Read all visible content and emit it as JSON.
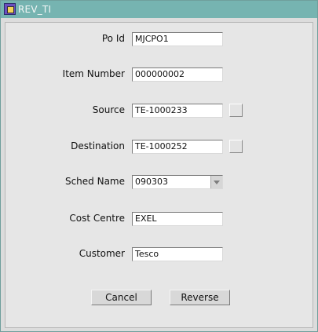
{
  "window": {
    "title": "REV_TI"
  },
  "form": {
    "po_id": {
      "label": "Po Id",
      "value": "MJCPO1"
    },
    "item_number": {
      "label": "Item Number",
      "value": "000000002"
    },
    "source": {
      "label": "Source",
      "value": "TE-1000233"
    },
    "destination": {
      "label": "Destination",
      "value": "TE-1000252"
    },
    "sched_name": {
      "label": "Sched Name",
      "value": "090303"
    },
    "cost_centre": {
      "label": "Cost Centre",
      "value": "EXEL"
    },
    "customer": {
      "label": "Customer",
      "value": "Tesco"
    }
  },
  "buttons": {
    "cancel": "Cancel",
    "reverse": "Reverse"
  },
  "colors": {
    "titlebar": "#76b4b1",
    "background": "#e6e6e6"
  }
}
